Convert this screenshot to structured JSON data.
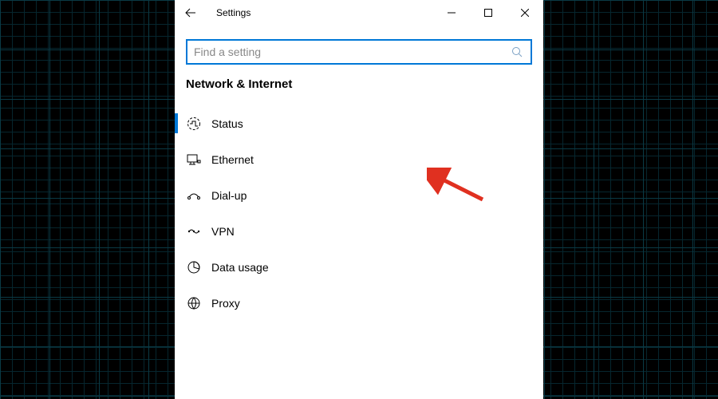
{
  "window": {
    "title": "Settings"
  },
  "search": {
    "placeholder": "Find a setting"
  },
  "section": {
    "title": "Network & Internet"
  },
  "nav": {
    "items": [
      {
        "label": "Status",
        "icon": "status-icon",
        "selected": true
      },
      {
        "label": "Ethernet",
        "icon": "ethernet-icon",
        "selected": false
      },
      {
        "label": "Dial-up",
        "icon": "dialup-icon",
        "selected": false
      },
      {
        "label": "VPN",
        "icon": "vpn-icon",
        "selected": false
      },
      {
        "label": "Data usage",
        "icon": "data-usage-icon",
        "selected": false
      },
      {
        "label": "Proxy",
        "icon": "proxy-icon",
        "selected": false
      }
    ]
  },
  "annotation": {
    "arrow_color": "#e03020"
  }
}
